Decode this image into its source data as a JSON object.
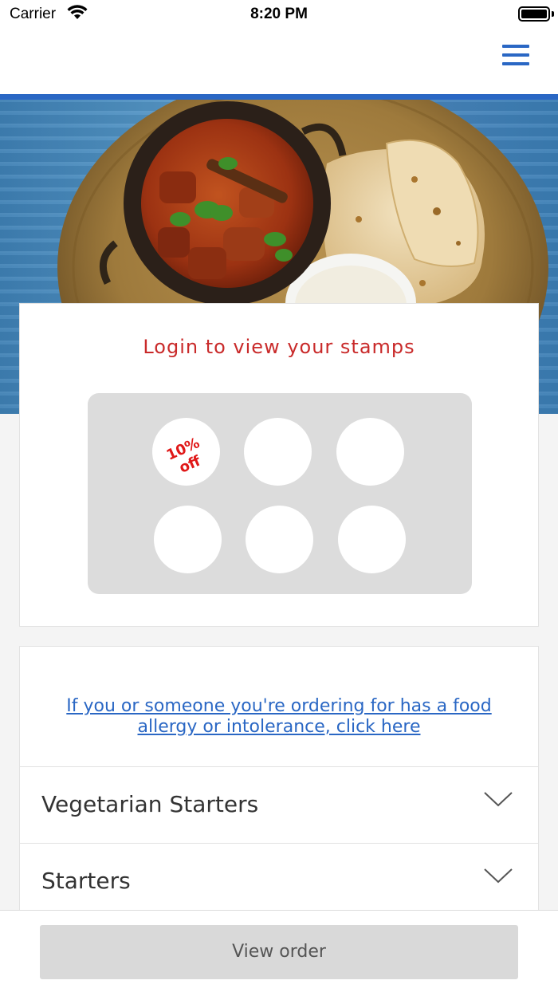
{
  "status_bar": {
    "carrier": "Carrier",
    "time": "8:20 PM"
  },
  "header": {
    "menu_icon": "hamburger-menu-icon",
    "accent_color": "#2a67c4"
  },
  "hero": {
    "description_icon": "food-photo"
  },
  "stamps": {
    "title": "Login to view your stamps",
    "title_color": "#c92a2a",
    "total": 6,
    "reward_text": [
      "10%",
      "off"
    ],
    "reward_color": "#e01818"
  },
  "allergy": {
    "link_text": "If you or someone you're ordering for has a food allergy or intolerance, click here"
  },
  "categories": [
    {
      "label": "Vegetarian Starters",
      "icon": "chevron-down-icon"
    },
    {
      "label": "Starters",
      "icon": "chevron-down-icon"
    }
  ],
  "footer": {
    "button_label": "View order"
  }
}
